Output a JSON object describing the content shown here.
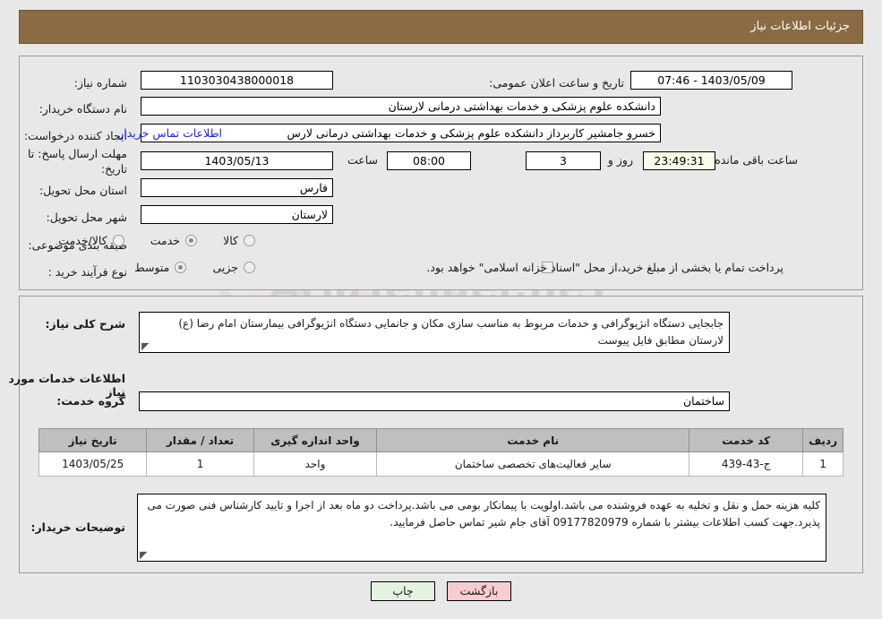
{
  "header": {
    "title": "جزئیات اطلاعات نیاز"
  },
  "watermark": {
    "text": "AriaTender.neT"
  },
  "form": {
    "labels": {
      "need_number": "شماره نیاز:",
      "buyer_org": "نام دستگاه خریدار:",
      "request_creator": "ایجاد کننده درخواست:",
      "deadline": "مهلت ارسال پاسخ: تا تاریخ:",
      "province": "استان محل تحویل:",
      "city": "شهر محل تحویل:",
      "category": "طبقه بندی موضوعی:",
      "process_type": "نوع فرآیند خرید :",
      "public_announce_datetime": "تاریخ و ساعت اعلان عمومی:",
      "hour": "ساعت",
      "days_and": "روز و",
      "time_remaining": "ساعت باقی مانده"
    },
    "values": {
      "need_number": "1103030438000018",
      "public_announce_datetime": "1403/05/09 - 07:46",
      "buyer_org": "دانشکده علوم پزشکی و خدمات بهداشتی  درمانی لارستان",
      "request_creator": "خسرو جامشیر کاربرداز دانشکده علوم پزشکی و خدمات بهداشتی  درمانی لارس",
      "contact_link": "اطلاعات تماس خریدار",
      "deadline_date": "1403/05/13",
      "deadline_hour": "08:00",
      "days_left": "3",
      "time_left": "23:49:31",
      "province": "فارس",
      "city": "لارستان"
    },
    "category_options": [
      {
        "label": "کالا",
        "selected": false
      },
      {
        "label": "خدمت",
        "selected": true
      },
      {
        "label": "کالا/خدمت",
        "selected": false
      }
    ],
    "process_options": [
      {
        "label": "جزیی",
        "selected": false
      },
      {
        "label": "متوسط",
        "selected": true
      }
    ],
    "treasury": {
      "checked": false,
      "text": "پرداخت تمام یا بخشی از مبلغ خرید،از محل \"اسناد خزانه اسلامی\" خواهد بود."
    }
  },
  "details": {
    "general_need_label": "شرح کلی نیاز:",
    "general_need_text": "جابجایی دستگاه انژیوگرافی و خدمات مربوط به مناسب سازی مکان و جانمایی دستگاه انژیوگرافی بیمارستان امام رضا (ع) لارستان مطابق فایل پیوست",
    "services_section_title": "اطلاعات خدمات مورد نیاز",
    "service_group_label": "گروه خدمت:",
    "service_group_value": "ساختمان"
  },
  "table": {
    "columns": [
      "ردیف",
      "کد خدمت",
      "نام خدمت",
      "واحد اندازه گیری",
      "تعداد / مقدار",
      "تاریخ نیاز"
    ],
    "rows": [
      {
        "row": "1",
        "service_code": "ج-43-439",
        "service_name": "سایر فعالیت‌های تخصصی ساختمان",
        "unit": "واحد",
        "quantity": "1",
        "need_date": "1403/05/25"
      }
    ]
  },
  "buyer_notes": {
    "label": "توضیحات خریدار:",
    "text": "کلیه هزینه حمل و نقل و تخلیه به عهده فروشنده می باشد.اولویت با پیمانکار بومی می باشد.پرداخت دو ماه بعد از اجرا و تایید کارشناس فنی صورت می پذیرد.جهت کسب اطلاعات بیشتر با شماره 09177820979 آقای جام شیر تماس حاصل فرمایید."
  },
  "footer": {
    "print_label": "چاپ",
    "back_label": "بازگشت"
  },
  "colors": {
    "header_bar": "#8a6b43",
    "link": "#1f24d8",
    "back_button": "#f9ccd0",
    "print_button": "#e3f3e0",
    "table_header": "#c0bfbf"
  }
}
